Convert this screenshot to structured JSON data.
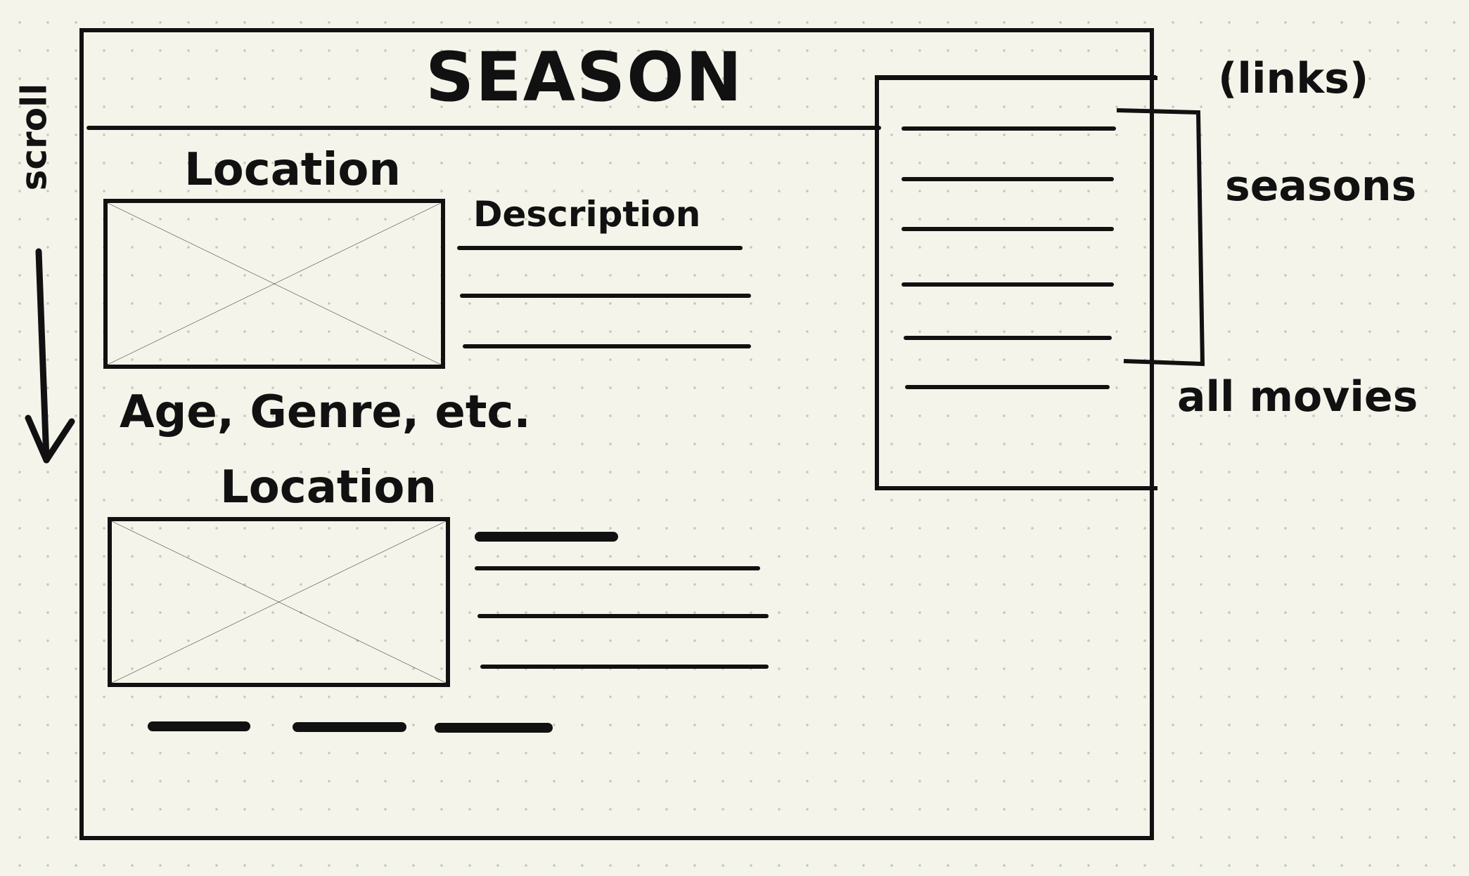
{
  "header": {
    "title": "SEASON"
  },
  "annotations": {
    "scroll": "scroll",
    "links": "(links)",
    "seasons": "seasons",
    "all_movies": "all movies"
  },
  "sections": [
    {
      "location_label": "Location",
      "description_label": "Description",
      "meta_label": "Age, Genre, etc."
    },
    {
      "location_label": "Location"
    }
  ],
  "sidebar": {
    "link_count": 6
  }
}
